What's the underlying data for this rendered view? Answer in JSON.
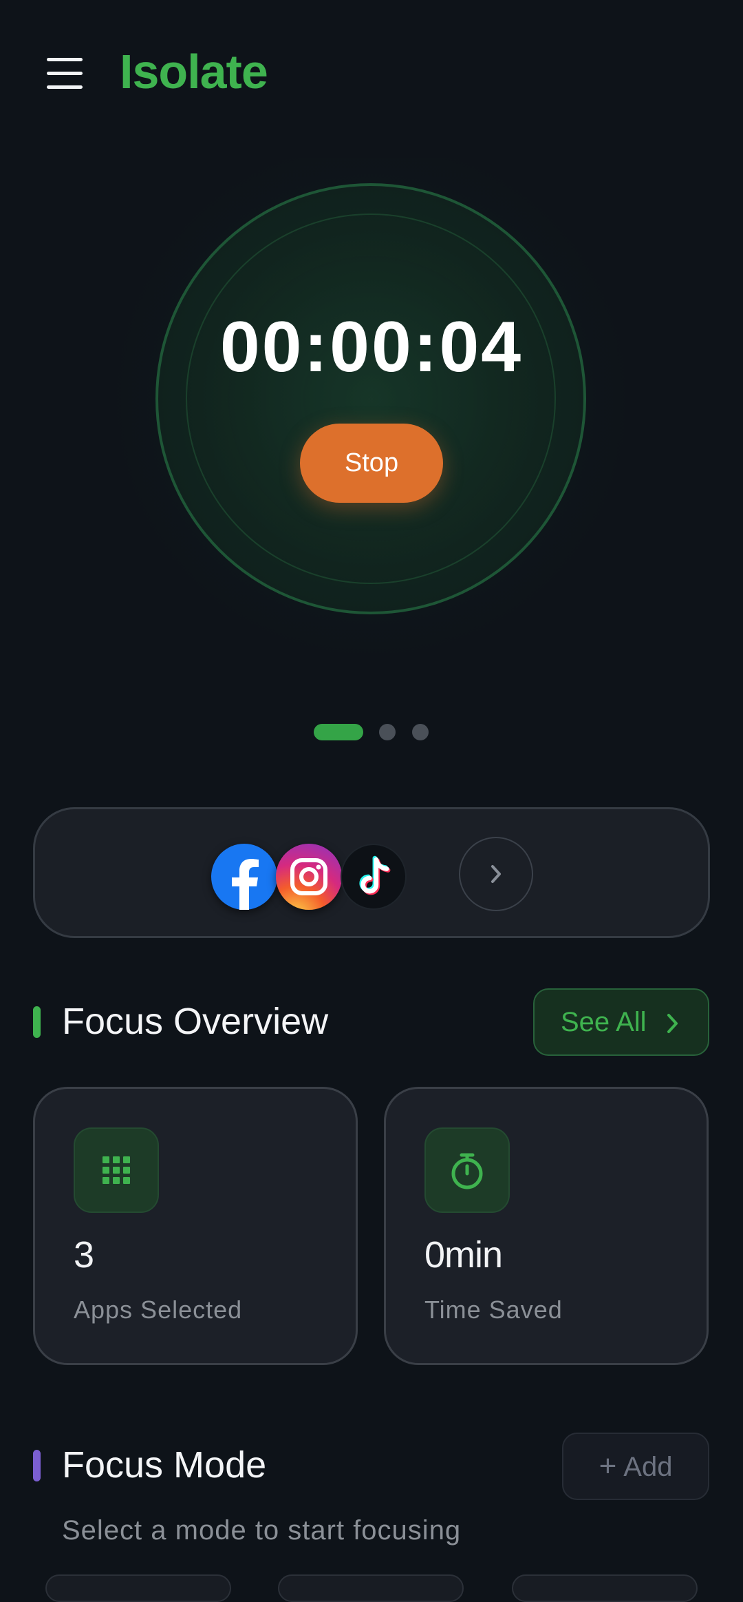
{
  "header": {
    "title": "Isolate",
    "menu_icon": "hamburger-menu-icon"
  },
  "timer": {
    "time": "00:00:04",
    "stop_label": "Stop",
    "ring_color": "#2a824c"
  },
  "pager": {
    "total": 3,
    "active": 1
  },
  "blocked_apps": {
    "items": [
      {
        "name": "facebook",
        "icon": "facebook-icon"
      },
      {
        "name": "instagram",
        "icon": "instagram-icon"
      },
      {
        "name": "tiktok",
        "icon": "tiktok-icon"
      }
    ],
    "more_icon": "chevron-right-icon"
  },
  "focus_overview": {
    "title": "Focus Overview",
    "see_all_label": "See All",
    "accent": "#3fb34f",
    "stats": [
      {
        "icon": "apps-grid-icon",
        "value": "3",
        "label": "Apps Selected"
      },
      {
        "icon": "stopwatch-icon",
        "value": "0min",
        "label": "Time Saved"
      }
    ]
  },
  "focus_mode": {
    "title": "Focus Mode",
    "add_label": "Add",
    "subtitle": "Select a mode to start focusing",
    "accent": "#7b5fd1"
  }
}
